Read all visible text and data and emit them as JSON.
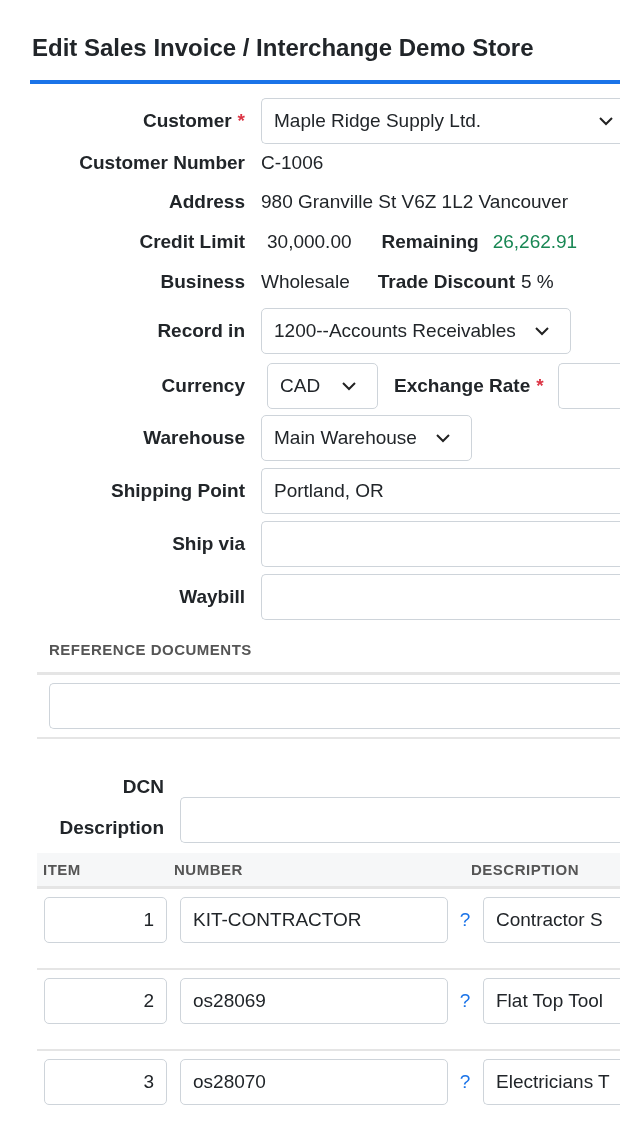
{
  "title": "Edit Sales Invoice / Interchange Demo Store",
  "fields": [
    {
      "kind": "combo",
      "label": "Customer",
      "required_mark": "*",
      "value": "Maple Ridge Supply Ltd."
    },
    {
      "kind": "text",
      "label": "Customer Number",
      "value": "C-1006"
    },
    {
      "kind": "text",
      "label": "Address",
      "value": "980 Granville St V6Z 1L2 Vancouver"
    },
    {
      "kind": "balance",
      "label": "Credit Limit",
      "value": "30,000.00",
      "label_2": "Remaining",
      "value_2": "26,262.91"
    },
    {
      "kind": "pair",
      "label": "Business",
      "value": "Wholesale",
      "label_2": "Trade Discount",
      "value_2": "5 %"
    },
    {
      "kind": "select",
      "label": "Record in",
      "value": "1200--Accounts Receivables"
    },
    {
      "kind": "currency",
      "label": "Currency",
      "value": "CAD",
      "label_2": "Exchange Rate",
      "required_mark_2": "*"
    },
    {
      "kind": "select",
      "label": "Warehouse",
      "value": "Main Warehouse"
    },
    {
      "kind": "input",
      "label": "Shipping Point",
      "value": "Portland, OR"
    },
    {
      "kind": "input",
      "label": "Ship via"
    },
    {
      "kind": "input",
      "label": "Waybill"
    }
  ],
  "reference_documents": {
    "title": "REFERENCE DOCUMENTS"
  },
  "dcn": {
    "label": "DCN",
    "description_label": "Description"
  },
  "table": {
    "columns": [
      "ITEM",
      "NUMBER",
      "DESCRIPTION"
    ],
    "rows": [
      {
        "item": "1",
        "number": "KIT-CONTRACTOR",
        "help": "?",
        "description": "Contractor S"
      },
      {
        "item": "2",
        "number": "os28069",
        "help": "?",
        "description": "Flat Top Tool"
      },
      {
        "item": "3",
        "number": "os28070",
        "help": "?",
        "description": "Electricians T"
      }
    ]
  }
}
